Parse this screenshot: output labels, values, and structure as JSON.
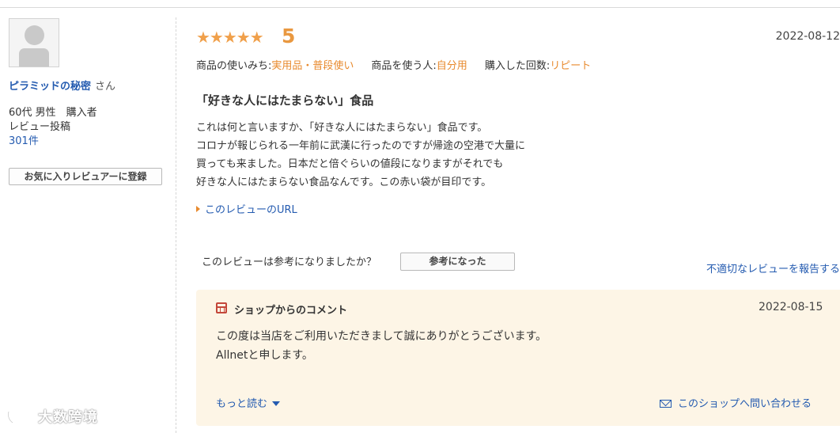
{
  "reviewer": {
    "name": "ピラミッドの秘密",
    "honorific": "さん",
    "demographics": "60代 男性　購入者",
    "posts_label": "レビュー投稿",
    "posts_count": "301件",
    "favorite_button": "お気に入りレビュアーに登録"
  },
  "review": {
    "stars": "★★★★★",
    "rating": 5,
    "rating_text": "5",
    "date": "2022-08-12",
    "usage_label": "商品の使いみち:",
    "usage_value": "実用品・普段使い",
    "user_label": "商品を使う人:",
    "user_value": "自分用",
    "times_label": "購入した回数:",
    "times_value": "リピート",
    "title": "「好きな人にはたまらない」食品",
    "body_lines": [
      "これは何と言いますか、「好きな人にはたまらない」食品です。",
      "コロナが報じられる一年前に武漢に行ったのですが帰途の空港で大量に",
      "買っても来ました。日本だと倍ぐらいの値段になりますがそれでも",
      "好きな人にはたまらない食品なんです。この赤い袋が目印です。"
    ],
    "url_link": "このレビューのURL"
  },
  "helpful": {
    "question": "このレビューは参考になりましたか？",
    "button": "参考になった",
    "report_link": "不適切なレビューを報告する"
  },
  "shop_comment": {
    "icon": "shop-icon",
    "label": "ショップからのコメント",
    "date": "2022-08-15",
    "body_lines": [
      "この度は当店をご利用いただきまして誠にありがとうございます。",
      "Allnetと申します。"
    ],
    "read_more": "もっと読む",
    "contact_link": "このショップへ問い合わせる"
  },
  "watermark": {
    "text": "大数跨境"
  },
  "colors": {
    "link": "#245bb0",
    "accent_orange": "#e88a2e",
    "star": "#f0a04b",
    "shop_box_bg": "#fdf5e6",
    "shop_icon": "#c4473a"
  }
}
